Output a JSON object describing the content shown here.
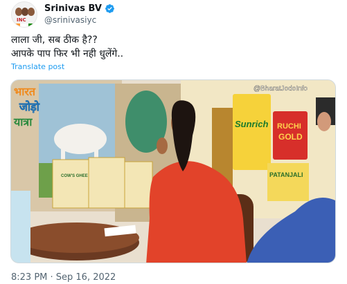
{
  "author": {
    "name": "Srinivas BV",
    "handle": "@srinivasiyc",
    "avatar_tag": "INC",
    "verified_icon": "verified-badge-icon"
  },
  "tweet": {
    "line1": "लाला जी, सब ठीक है??",
    "line2": "आपके पाप फिर भी नही धुलेंगे..",
    "translate_label": "Translate post"
  },
  "media": {
    "watermark": "@BharatJodoInfo",
    "logo_lines": [
      "भारत",
      "जोड़ो",
      "यात्रा"
    ],
    "sunrich_label": "Sunrich",
    "ruchi_top": "RUCHI",
    "ruchi_bottom": "GOLD",
    "patanjali_label": "PATANJALI",
    "ghee_label": "COW'S GHEE"
  },
  "meta": {
    "timestamp": "8:23 PM · Sep 16, 2022"
  },
  "colors": {
    "link": "#1d9bf0",
    "verified": "#1d9bf0",
    "robe": "#e2432a",
    "muted": "#536471"
  }
}
